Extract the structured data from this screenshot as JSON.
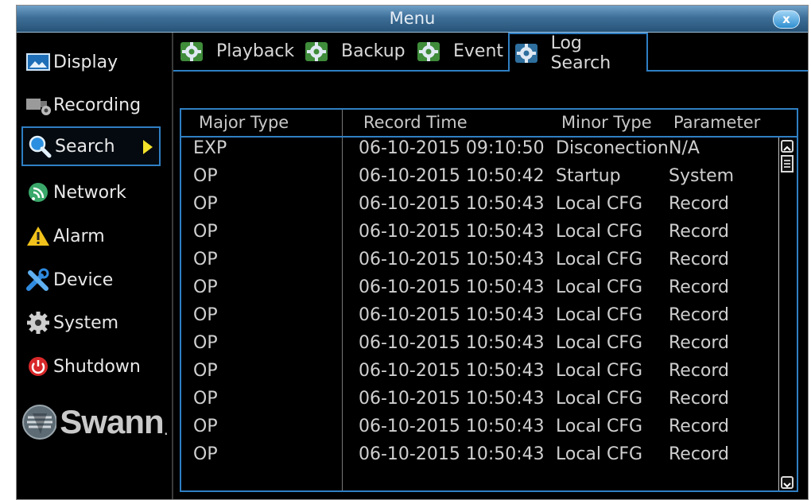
{
  "window": {
    "title": "Menu",
    "close_label": "x"
  },
  "sidebar": {
    "items": [
      {
        "label": "Display",
        "icon": "display-icon"
      },
      {
        "label": "Recording",
        "icon": "recording-icon"
      },
      {
        "label": "Search",
        "icon": "search-icon",
        "active": true
      },
      {
        "label": "Network",
        "icon": "network-icon"
      },
      {
        "label": "Alarm",
        "icon": "alarm-icon"
      },
      {
        "label": "Device",
        "icon": "device-icon"
      },
      {
        "label": "System",
        "icon": "system-icon"
      },
      {
        "label": "Shutdown",
        "icon": "shutdown-icon"
      }
    ],
    "logo_text": "Swann",
    "logo_mark": "."
  },
  "tabs": [
    {
      "label": "Playback"
    },
    {
      "label": "Backup"
    },
    {
      "label": "Event"
    },
    {
      "label": "Log Search",
      "active": true
    }
  ],
  "table": {
    "headers": [
      "Major Type",
      "Record Time",
      "Minor Type",
      "Parameter"
    ],
    "rows": [
      [
        "EXP",
        "06-10-2015 09:10:50",
        "Disconection",
        "N/A"
      ],
      [
        "OP",
        "06-10-2015 10:50:42",
        "Startup",
        "System"
      ],
      [
        "OP",
        "06-10-2015 10:50:43",
        "Local CFG",
        "Record"
      ],
      [
        "OP",
        "06-10-2015 10:50:43",
        "Local CFG",
        "Record"
      ],
      [
        "OP",
        "06-10-2015 10:50:43",
        "Local CFG",
        "Record"
      ],
      [
        "OP",
        "06-10-2015 10:50:43",
        "Local CFG",
        "Record"
      ],
      [
        "OP",
        "06-10-2015 10:50:43",
        "Local CFG",
        "Record"
      ],
      [
        "OP",
        "06-10-2015 10:50:43",
        "Local CFG",
        "Record"
      ],
      [
        "OP",
        "06-10-2015 10:50:43",
        "Local CFG",
        "Record"
      ],
      [
        "OP",
        "06-10-2015 10:50:43",
        "Local CFG",
        "Record"
      ],
      [
        "OP",
        "06-10-2015 10:50:43",
        "Local CFG",
        "Record"
      ],
      [
        "OP",
        "06-10-2015 10:50:43",
        "Local CFG",
        "Record"
      ]
    ]
  },
  "colors": {
    "accent": "#2f7fc3",
    "title_bar": "#3e6f98",
    "active_arrow": "#f3e12a"
  }
}
